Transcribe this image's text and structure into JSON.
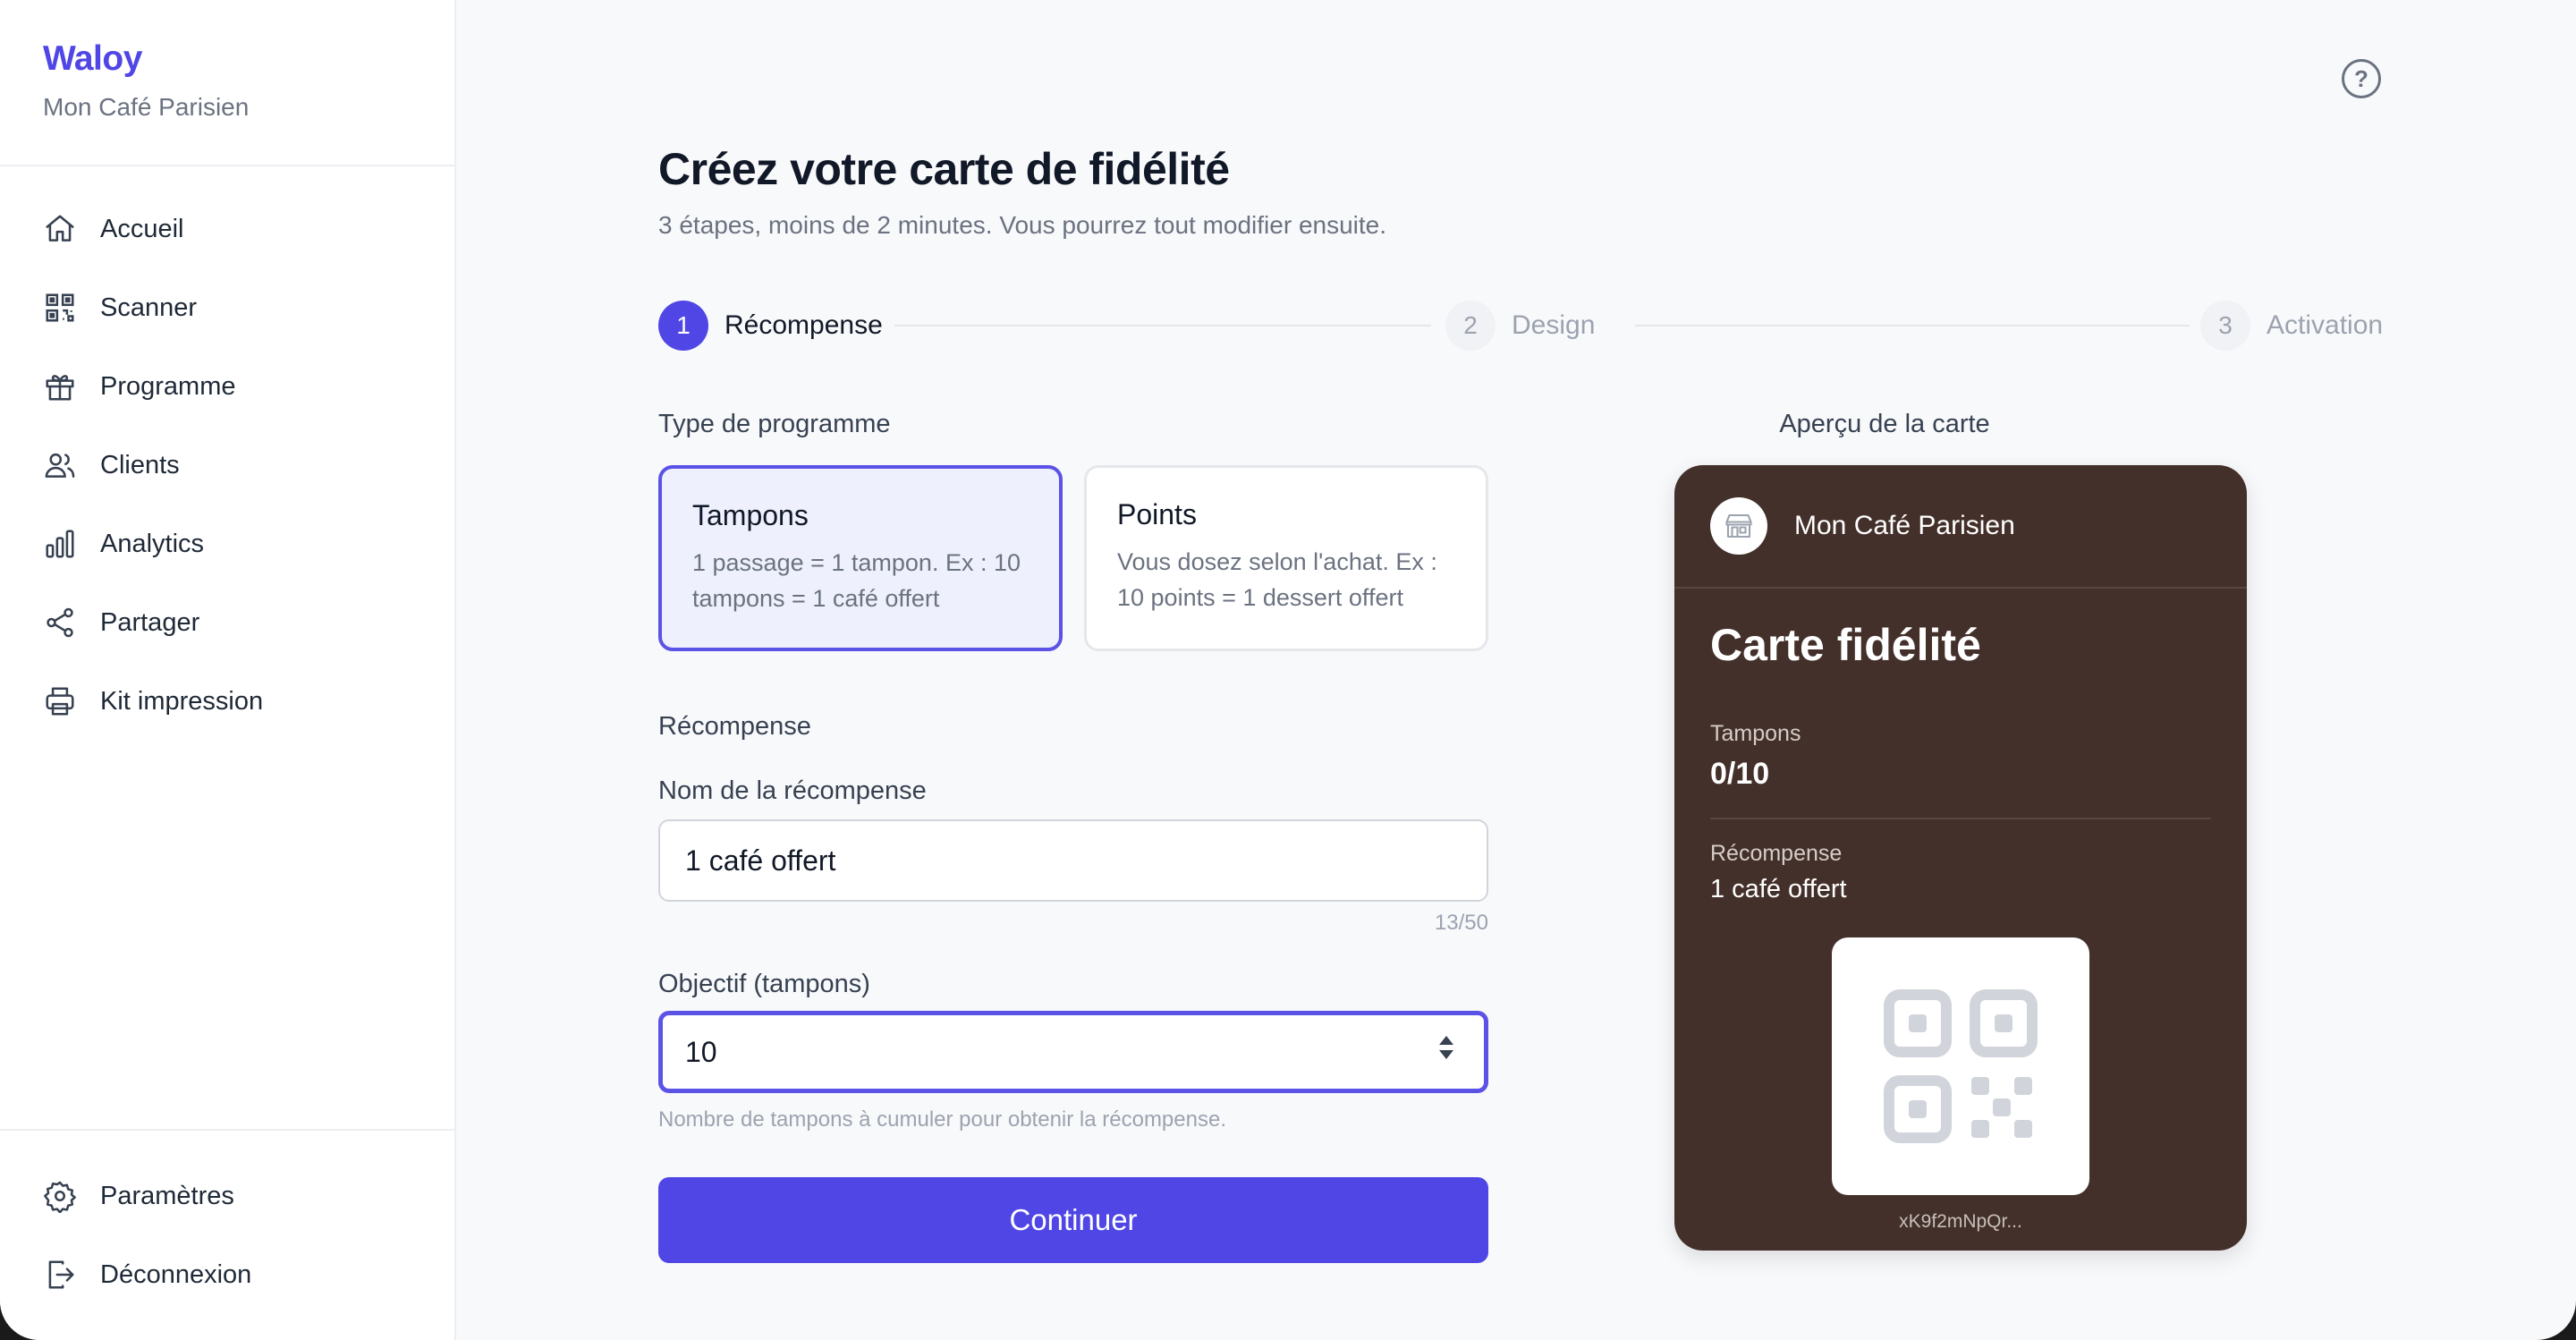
{
  "brand": {
    "name": "Waloy",
    "shop": "Mon Café Parisien"
  },
  "sidebar": {
    "items": [
      {
        "label": "Accueil",
        "icon": "home-icon"
      },
      {
        "label": "Scanner",
        "icon": "qr-icon"
      },
      {
        "label": "Programme",
        "icon": "gift-icon"
      },
      {
        "label": "Clients",
        "icon": "users-icon"
      },
      {
        "label": "Analytics",
        "icon": "bar-chart-icon"
      },
      {
        "label": "Partager",
        "icon": "share-icon"
      },
      {
        "label": "Kit impression",
        "icon": "printer-icon"
      }
    ],
    "bottom": [
      {
        "label": "Paramètres",
        "icon": "gear-icon"
      },
      {
        "label": "Déconnexion",
        "icon": "logout-icon"
      }
    ]
  },
  "header": {
    "title": "Créez votre carte de fidélité",
    "subtitle": "3 étapes, moins de 2 minutes. Vous pourrez tout modifier ensuite.",
    "help": "?"
  },
  "stepper": {
    "steps": [
      {
        "num": "1",
        "label": "Récompense",
        "active": true
      },
      {
        "num": "2",
        "label": "Design",
        "active": false
      },
      {
        "num": "3",
        "label": "Activation",
        "active": false
      }
    ]
  },
  "form": {
    "type_label": "Type de programme",
    "types": [
      {
        "title": "Tampons",
        "desc": "1 passage = 1 tampon. Ex : 10 tampons = 1 café offert",
        "selected": true
      },
      {
        "title": "Points",
        "desc": "Vous dosez selon l'achat. Ex : 10 points = 1 dessert offert",
        "selected": false
      }
    ],
    "section_label": "Récompense",
    "reward_name_label": "Nom de la récompense",
    "reward_name_value": "1 café offert",
    "reward_counter": "13/50",
    "goal_label": "Objectif (tampons)",
    "goal_value": "10",
    "goal_hint": "Nombre de tampons à cumuler pour obtenir la récompense.",
    "continue_label": "Continuer"
  },
  "preview": {
    "label": "Aperçu de la carte",
    "shop": "Mon Café Parisien",
    "title": "Carte fidélité",
    "stamps_label": "Tampons",
    "stamps_value": "0/10",
    "reward_label": "Récompense",
    "reward_value": "1 café offert",
    "code": "xK9f2mNpQr...",
    "card_color": "#44302a"
  },
  "colors": {
    "accent": "#4f46e5"
  }
}
